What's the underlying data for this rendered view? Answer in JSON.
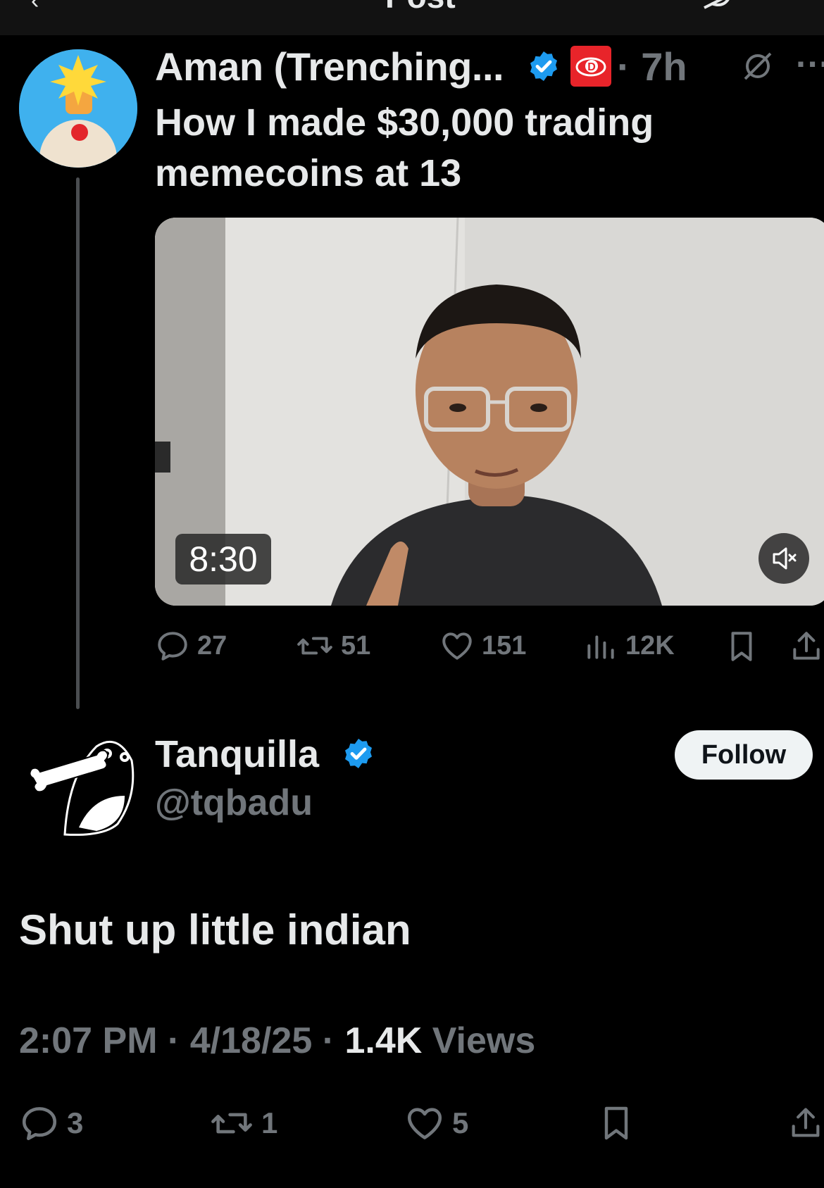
{
  "topbar": {
    "back_icon": "‹",
    "title": "Post",
    "grok_icon": "grok-icon"
  },
  "parent_tweet": {
    "author_name": "Aman (Trenching...",
    "time": "7h",
    "text": "How I made $30,000 trading memecoins at 13",
    "video": {
      "duration": "8:30",
      "muted": true
    },
    "actions": {
      "replies": "27",
      "reposts": "51",
      "likes": "151",
      "views": "12K"
    }
  },
  "reply_tweet": {
    "author_name": "Tanquilla",
    "handle": "@tqbadu",
    "follow_label": "Follow",
    "text": "Shut up little indian",
    "time": "2:07 PM",
    "date": "4/18/25",
    "views_count": "1.4K",
    "views_label": "Views",
    "actions": {
      "replies": "3",
      "reposts": "1",
      "likes": "5"
    }
  },
  "colors": {
    "background": "#000000",
    "text": "#e7e9ea",
    "muted": "#71767b",
    "verified": "#1d9bf0"
  }
}
